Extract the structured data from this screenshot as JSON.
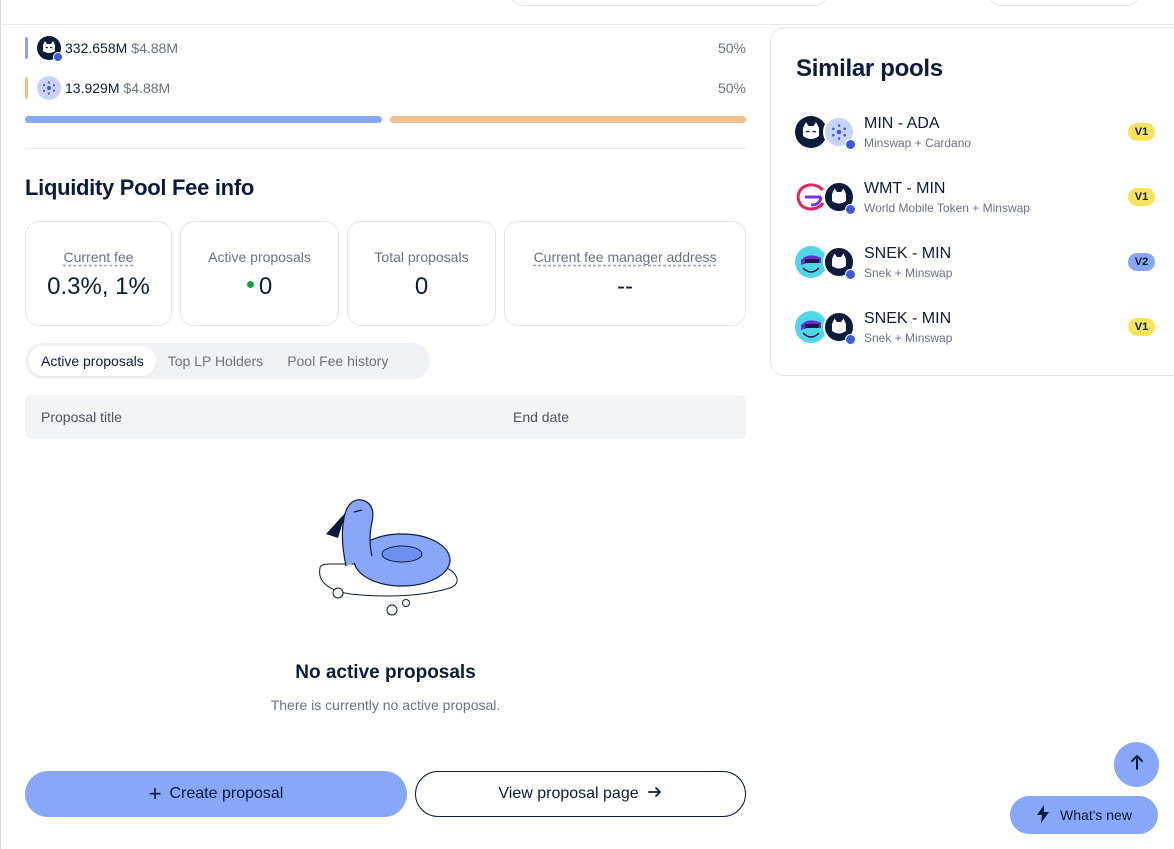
{
  "pool_tokens": [
    {
      "amount": "332.658M",
      "usd": "$4.88M",
      "percent": "50%",
      "color": "#89a7f9",
      "icon": "minswap-cat-icon"
    },
    {
      "amount": "13.929M",
      "usd": "$4.88M",
      "percent": "50%",
      "color": "#f2c08f",
      "icon": "cardano-icon"
    }
  ],
  "ratio": {
    "left_fraction": 0.5,
    "left_color": "#89a7f9",
    "right_color": "#f2c08f"
  },
  "fee_info": {
    "title": "Liquidity Pool Fee info",
    "stats": [
      {
        "label": "Current fee",
        "value": "0.3%, 1%"
      },
      {
        "label": "Active proposals",
        "value": "0"
      },
      {
        "label": "Total proposals",
        "value": "0"
      },
      {
        "label": "Current fee manager address",
        "value": "--"
      }
    ]
  },
  "tabs": [
    "Active proposals",
    "Top LP Holders",
    "Pool Fee history"
  ],
  "active_tab": "Active proposals",
  "table": {
    "columns": [
      "Proposal title",
      "End date"
    ]
  },
  "empty_state": {
    "title": "No active proposals",
    "subtitle": "There is currently no active proposal."
  },
  "buttons": {
    "create": "Create proposal",
    "view": "View proposal page"
  },
  "similar_pools": {
    "title": "Similar pools",
    "items": [
      {
        "name": "MIN - ADA",
        "sub": "Minswap + Cardano",
        "version": "V1"
      },
      {
        "name": "WMT - MIN",
        "sub": "World Mobile Token + Minswap",
        "version": "V1"
      },
      {
        "name": "SNEK - MIN",
        "sub": "Snek + Minswap",
        "version": "V2"
      },
      {
        "name": "SNEK - MIN",
        "sub": "Snek + Minswap",
        "version": "V1"
      }
    ]
  },
  "whats_new": "What's new",
  "colors": {
    "accent": "#89a7f9",
    "navy": "#0b1b3b",
    "ada_orange": "#f2c08f",
    "status_green": "#16a34a"
  }
}
